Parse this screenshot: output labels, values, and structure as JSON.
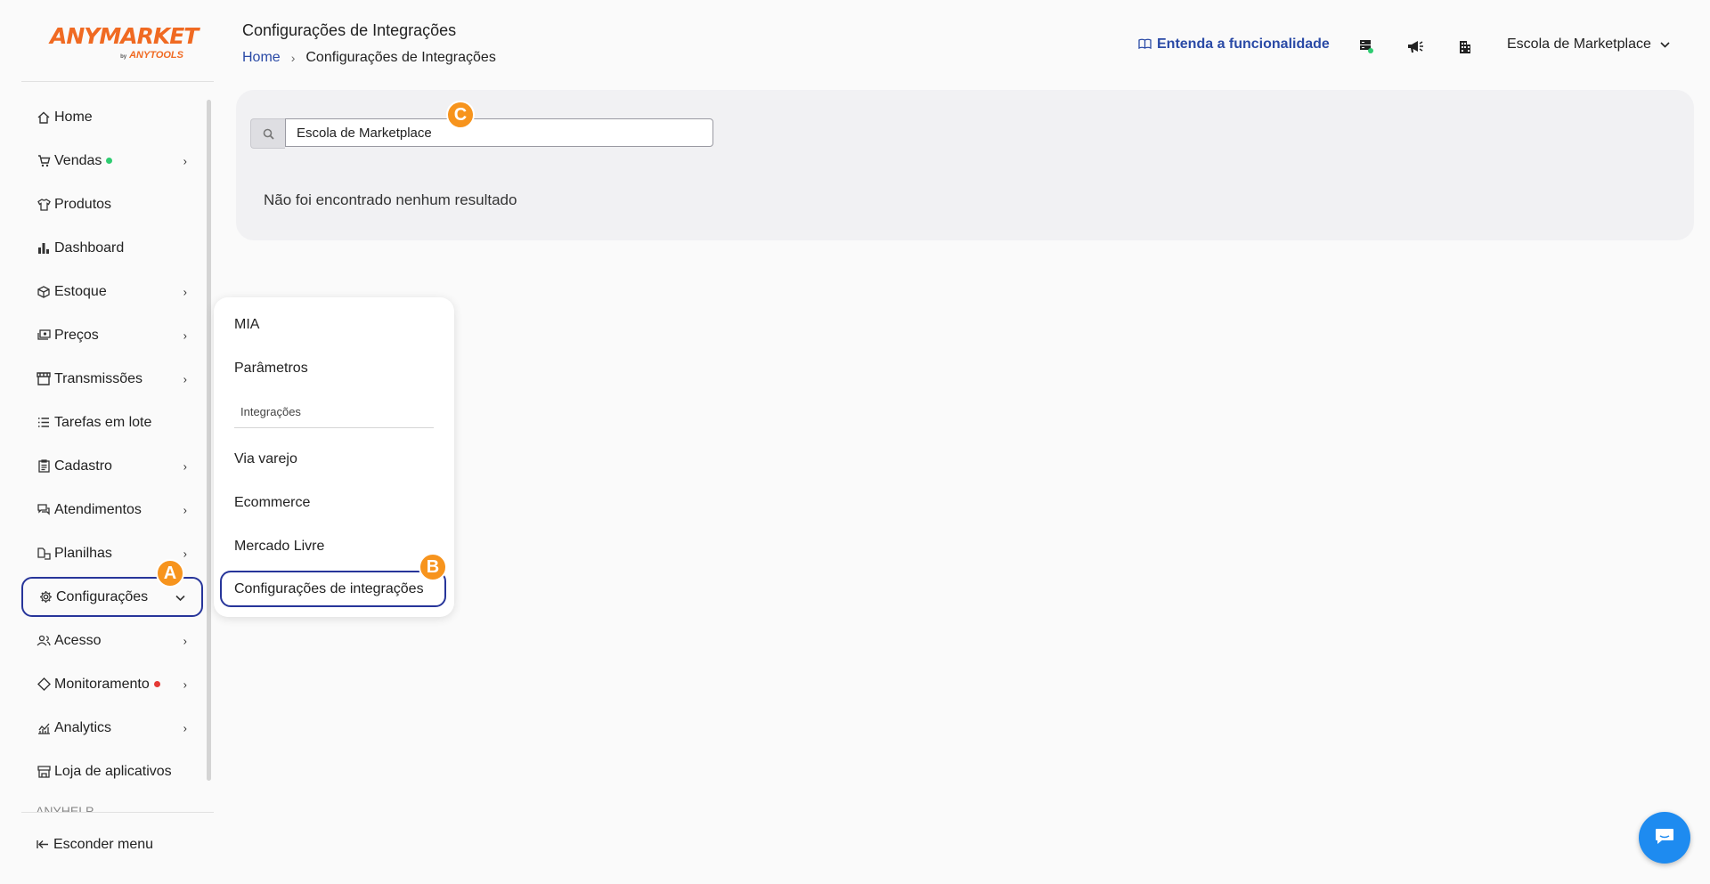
{
  "logo": {
    "main": "ANYMARKET",
    "by": "by",
    "sub": "ANYTOOLS"
  },
  "sidebar": {
    "items": [
      {
        "label": "Home",
        "icon": "home-icon",
        "chevron": false
      },
      {
        "label": "Vendas",
        "icon": "cart-icon",
        "chevron": true,
        "dot": "#2ecc71"
      },
      {
        "label": "Produtos",
        "icon": "shirt-icon",
        "chevron": false
      },
      {
        "label": "Dashboard",
        "icon": "bar-chart-icon",
        "chevron": false
      },
      {
        "label": "Estoque",
        "icon": "box-icon",
        "chevron": true
      },
      {
        "label": "Preços",
        "icon": "money-icon",
        "chevron": true
      },
      {
        "label": "Transmissões",
        "icon": "store-icon",
        "chevron": true
      },
      {
        "label": "Tarefas em lote",
        "icon": "list-icon",
        "chevron": false
      },
      {
        "label": "Cadastro",
        "icon": "clipboard-icon",
        "chevron": true
      },
      {
        "label": "Atendimentos",
        "icon": "chat-icon",
        "chevron": true
      },
      {
        "label": "Planilhas",
        "icon": "sheet-icon",
        "chevron": true
      },
      {
        "label": "Configurações",
        "icon": "gear-icon",
        "chevron": true,
        "active": true
      },
      {
        "label": "Acesso",
        "icon": "users-icon",
        "chevron": true
      },
      {
        "label": "Monitoramento",
        "icon": "diamond-icon",
        "chevron": true,
        "dot": "#e53935"
      },
      {
        "label": "Analytics",
        "icon": "analytics-icon",
        "chevron": true
      },
      {
        "label": "Loja de aplicativos",
        "icon": "shop-icon",
        "chevron": false
      }
    ],
    "cutoff_label": "ANYHELP",
    "hide_menu": "Esconder menu"
  },
  "header": {
    "title": "Configurações de Integrações",
    "breadcrumb_home": "Home",
    "breadcrumb_current": "Configurações de Integrações",
    "help_link": "Entenda a funcionalidade",
    "account": "Escola de Marketplace"
  },
  "main": {
    "search_value": "Escola de Marketplace",
    "no_result": "Não foi encontrado nenhum resultado"
  },
  "dropdown": {
    "items_top": [
      "MIA",
      "Parâmetros"
    ],
    "section": "Integrações",
    "items": [
      "Via varejo",
      "Ecommerce",
      "Mercado Livre"
    ],
    "active": "Configurações de integrações"
  },
  "badges": {
    "a": "A",
    "b": "B",
    "c": "C"
  },
  "colors": {
    "brand": "#f06a22",
    "accent": "#27359a",
    "link": "#2a4aa6",
    "badge": "#f7941d",
    "chat": "#1e8bf0"
  }
}
